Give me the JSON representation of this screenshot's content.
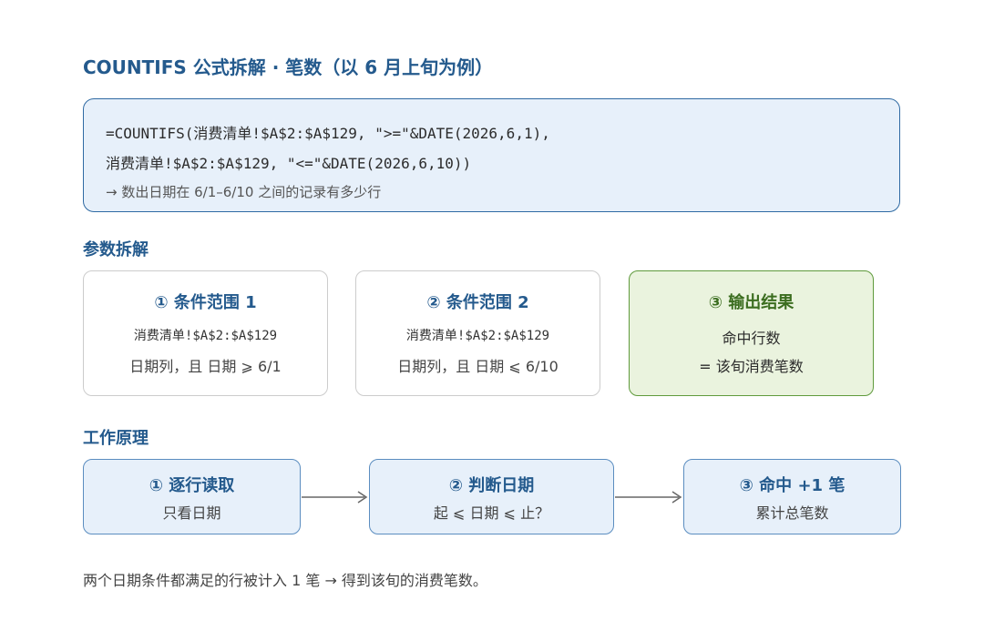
{
  "title": "COUNTIFS 公式拆解 · 笔数（以 6 月上旬为例）",
  "formula": {
    "line1": "=COUNTIFS(消费清单!$A$2:$A$129, \">=\"&DATE(2026,6,1),",
    "line2": "消费清单!$A$2:$A$129, \"<=\"&DATE(2026,6,10))",
    "note": "→ 数出日期在 6/1–6/10 之间的记录有多少行"
  },
  "params": {
    "heading": "参数拆解",
    "cards": [
      {
        "title": "① 条件范围 1",
        "line1": "消费清单!$A$2:$A$129",
        "line2": "日期列，且 日期 ⩾ 6/1"
      },
      {
        "title": "② 条件范围 2",
        "line1": "消费清单!$A$2:$A$129",
        "line2": "日期列，且 日期 ⩽ 6/10"
      },
      {
        "title": "③ 输出结果",
        "line1": "命中行数",
        "line2": "= 该旬消费笔数"
      }
    ]
  },
  "flow": {
    "heading": "工作原理",
    "steps": [
      {
        "title": "① 逐行读取",
        "sub": "只看日期"
      },
      {
        "title": "② 判断日期",
        "sub": "起 ⩽ 日期 ⩽ 止？"
      },
      {
        "title": "③ 命中 +1 笔",
        "sub": "累计总笔数"
      }
    ]
  },
  "footer": "两个日期条件都满足的行被计入 1 笔 → 得到该旬的消费笔数。",
  "colors": {
    "accent": "#245a8d",
    "box_fill": "#e7f0fa",
    "result_fill": "#eaf3de",
    "result_accent": "#3b6d1f"
  }
}
